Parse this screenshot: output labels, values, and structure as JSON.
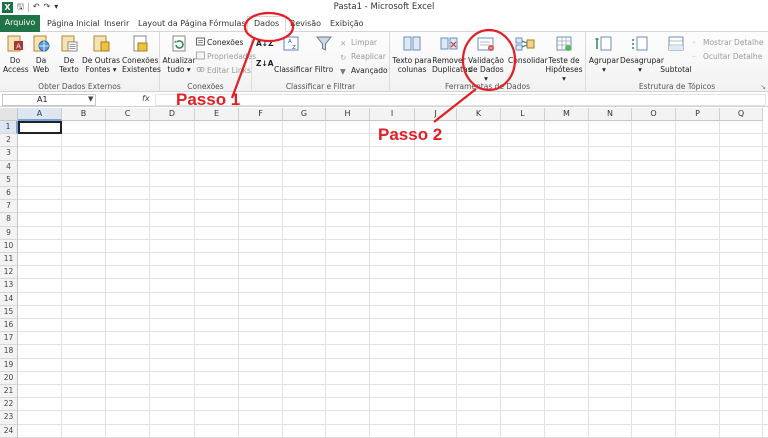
{
  "window": {
    "title": "Pasta1 - Microsoft Excel"
  },
  "quick_access": [
    "save-icon",
    "undo-icon",
    "redo-icon",
    "customize-icon"
  ],
  "tabs": [
    {
      "label": "Arquivo"
    },
    {
      "label": "Página Inicial"
    },
    {
      "label": "Inserir"
    },
    {
      "label": "Layout da Página"
    },
    {
      "label": "Fórmulas"
    },
    {
      "label": "Dados"
    },
    {
      "label": "Revisão"
    },
    {
      "label": "Exibição"
    }
  ],
  "active_tab": "Dados",
  "ribbon": {
    "external": {
      "label": "Obter Dados Externos",
      "buttons": [
        {
          "l1": "Do",
          "l2": "Access"
        },
        {
          "l1": "Da",
          "l2": "Web"
        },
        {
          "l1": "De",
          "l2": "Texto"
        },
        {
          "l1": "De Outras",
          "l2": "Fontes ▾"
        },
        {
          "l1": "Conexões",
          "l2": "Existentes"
        }
      ]
    },
    "connections": {
      "label": "Conexões",
      "refresh": {
        "l1": "Atualizar",
        "l2": "tudo ▾"
      },
      "items": [
        "Conexões",
        "Propriedades",
        "Editar Links"
      ]
    },
    "sort": {
      "label": "Classificar e Filtrar",
      "sort_btn": "Classificar",
      "filter_btn": "Filtro",
      "items": [
        "Limpar",
        "Reaplicar",
        "Avançado"
      ]
    },
    "tools": {
      "label": "Ferramentas de Dados",
      "buttons": [
        {
          "l1": "Texto para",
          "l2": "colunas"
        },
        {
          "l1": "Remover",
          "l2": "Duplicatas"
        },
        {
          "l1": "Validação",
          "l2": "de Dados ▾"
        },
        {
          "l1": "Consolidar",
          "l2": ""
        },
        {
          "l1": "Teste de",
          "l2": "Hipóteses ▾"
        }
      ]
    },
    "outline": {
      "label": "Estrutura de Tópicos",
      "buttons": [
        {
          "l1": "Agrupar",
          "l2": "▾"
        },
        {
          "l1": "Desagrupar",
          "l2": "▾"
        },
        {
          "l1": "Subtotal",
          "l2": ""
        }
      ],
      "items": [
        "Mostrar Detalhe",
        "Ocultar Detalhe"
      ]
    }
  },
  "formula_bar": {
    "name_box": "A1",
    "fx": "fx",
    "formula": ""
  },
  "grid": {
    "columns": [
      "A",
      "B",
      "C",
      "D",
      "E",
      "F",
      "G",
      "H",
      "I",
      "J",
      "K",
      "L",
      "M",
      "N",
      "O",
      "P",
      "Q"
    ],
    "rows": [
      "1",
      "2",
      "3",
      "4",
      "5",
      "6",
      "7",
      "8",
      "9",
      "10",
      "11",
      "12",
      "13",
      "14",
      "15",
      "16",
      "17",
      "18",
      "19",
      "20",
      "21",
      "22",
      "23",
      "24"
    ],
    "selected_cell": "A1"
  },
  "annotations": {
    "step1": "Passo 1",
    "step2": "Passo 2",
    "color": "#e31e24"
  },
  "colors": {
    "file_tab": "#1f7346",
    "selection": "#7aa3d6"
  }
}
